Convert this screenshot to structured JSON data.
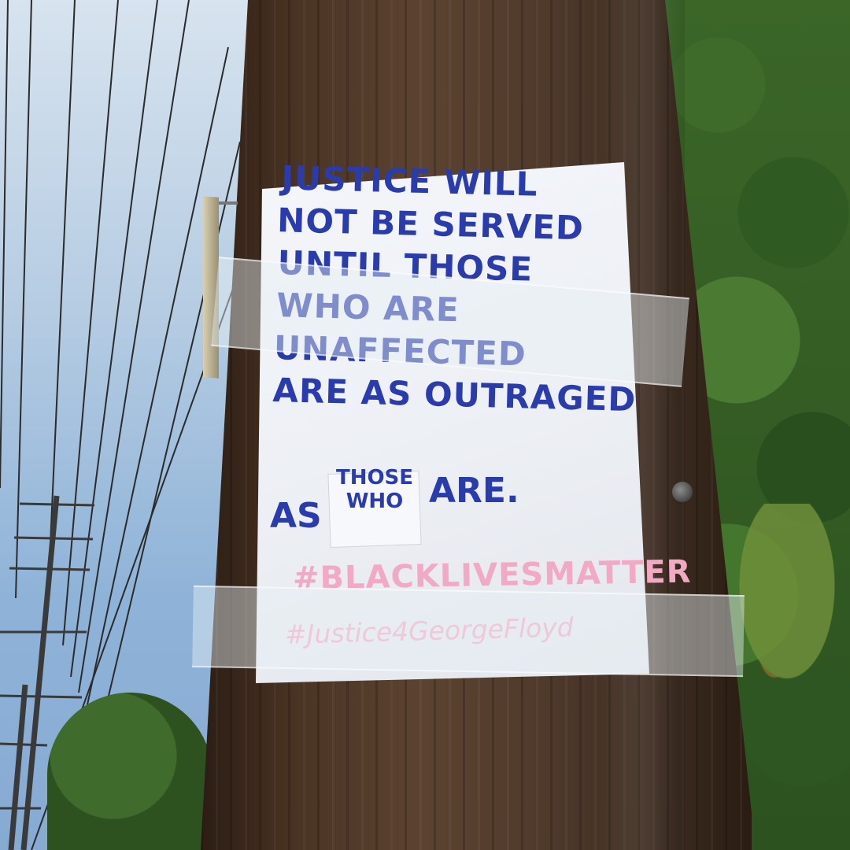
{
  "poster": {
    "lines": [
      "JUSTICE WILL",
      "NOT BE SERVED",
      "UNTIL THOSE",
      "WHO ARE",
      "UNAFFECTED",
      "ARE AS OUTRAGED"
    ],
    "last_line": {
      "start": "AS",
      "patch_top": "THOSE",
      "patch_bottom": "WHO",
      "end": "ARE."
    },
    "hashtag_1": "#BLACKLIVESMATTER",
    "hashtag_2": "#Justice4GeorgeFloyd",
    "ink_color": "#2a3cab",
    "hashtag_color": "#f2a9c4"
  }
}
